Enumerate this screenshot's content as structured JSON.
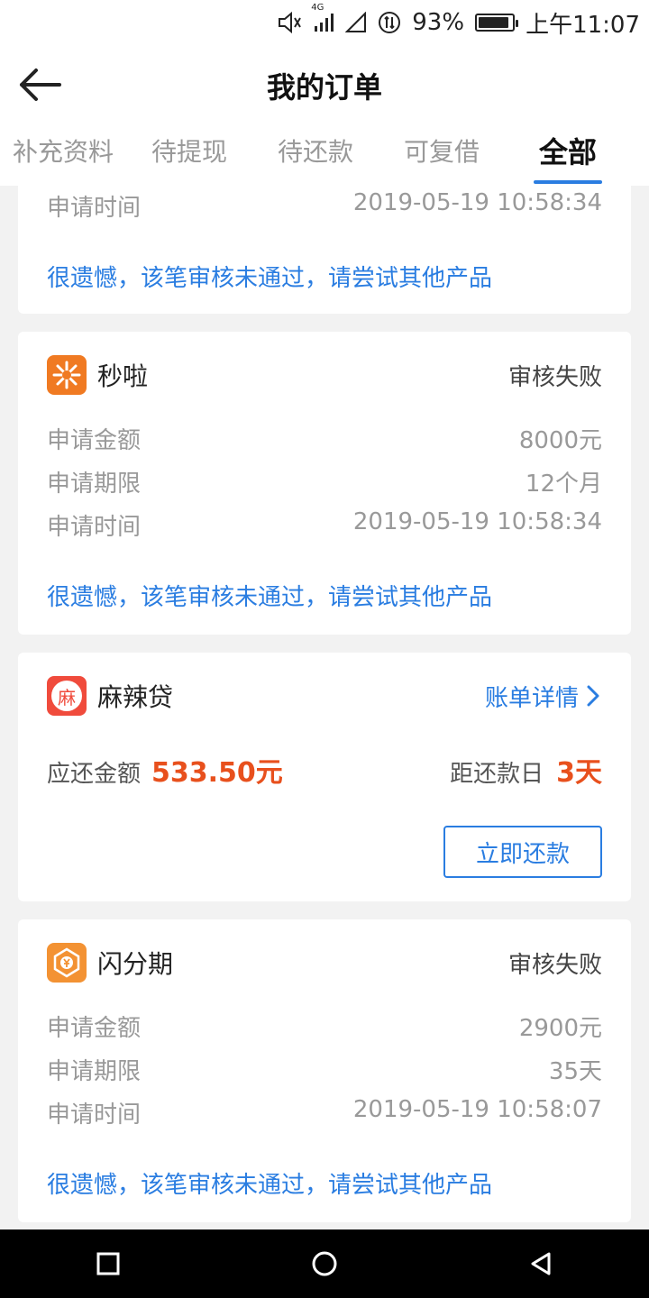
{
  "status_bar": {
    "network": "4G",
    "battery": "93%",
    "battery_level": 0.93,
    "time": "上午11:07"
  },
  "header": {
    "title": "我的订单"
  },
  "tabs": [
    {
      "label": "补充资料",
      "active": false
    },
    {
      "label": "待提现",
      "active": false
    },
    {
      "label": "待还款",
      "active": false
    },
    {
      "label": "可复借",
      "active": false
    },
    {
      "label": "全部",
      "active": true
    }
  ],
  "orders": {
    "partial": {
      "time_label": "申请时间",
      "time_value": "2019-05-19 10:58:34",
      "message": "很遗憾，该笔审核未通过，请尝试其他产品"
    },
    "miaola": {
      "brand": "秒啦",
      "status": "审核失败",
      "amount_label": "申请金额",
      "amount_value": "8000元",
      "term_label": "申请期限",
      "term_value": "12个月",
      "time_label": "申请时间",
      "time_value": "2019-05-19 10:58:34",
      "message": "很遗憾，该笔审核未通过，请尝试其他产品"
    },
    "maladai": {
      "brand": "麻辣贷",
      "logo_char": "麻",
      "detail_link": "账单详情",
      "due_label": "应还金额",
      "due_amount": "533.50元",
      "days_label": "距还款日",
      "days_value": "3天",
      "repay_button": "立即还款"
    },
    "shanfenqi": {
      "brand": "闪分期",
      "status": "审核失败",
      "amount_label": "申请金额",
      "amount_value": "2900元",
      "term_label": "申请期限",
      "term_value": "35天",
      "time_label": "申请时间",
      "time_value": "2019-05-19 10:58:07",
      "message": "很遗憾，该笔审核未通过，请尝试其他产品"
    }
  },
  "colors": {
    "accent": "#2a7de1",
    "highlight": "#e8501d",
    "miaola_logo": "#f07a22",
    "maladai_logo": "#f04b3c",
    "shanfenqi_logo": "#f39233"
  }
}
